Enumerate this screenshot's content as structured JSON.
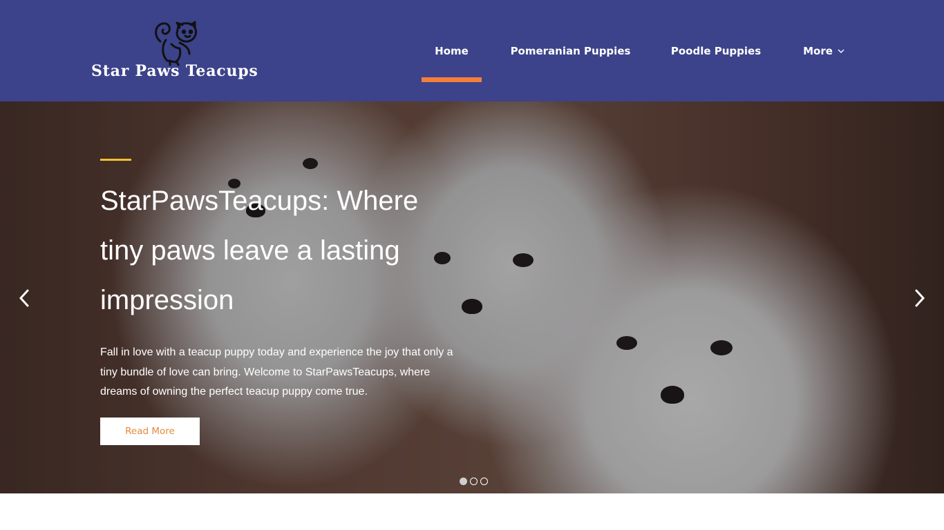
{
  "brand": {
    "name": "Star Paws Teacups",
    "logo_icon": "dog-mascot-icon"
  },
  "nav": {
    "items": [
      {
        "label": "Home",
        "active": true
      },
      {
        "label": "Pomeranian Puppies",
        "active": false
      },
      {
        "label": "Poodle Puppies",
        "active": false
      },
      {
        "label": "More",
        "active": false,
        "icon": "chevron-down-icon"
      }
    ]
  },
  "hero": {
    "title_lines": [
      "StarPawsTeacups: Where",
      "tiny paws leave a lasting",
      "impression"
    ],
    "description": "Fall in love with a teacup puppy today and experience the joy that only a tiny bundle of love can bring. Welcome to StarPawsTeacups, where dreams of owning the perfect teacup puppy come true.",
    "button_label": "Read More",
    "prev_icon": "chevron-left-icon",
    "next_icon": "chevron-right-icon",
    "slide_count": 3,
    "active_slide": 1
  },
  "colors": {
    "header_bg": "#3c438a",
    "active_underline": "#f47f3c",
    "accent_line": "#f2c12e",
    "button_text": "#e48a3f"
  }
}
